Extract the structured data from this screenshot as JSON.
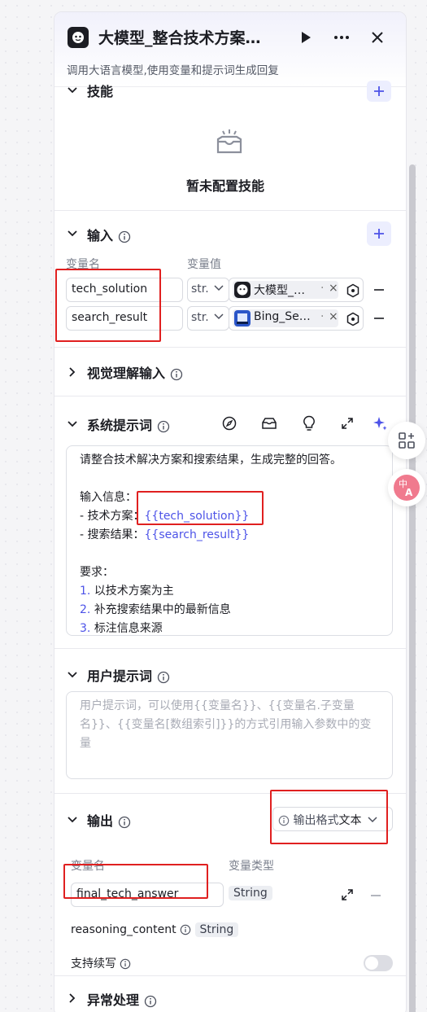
{
  "header": {
    "title": "大模型_整合技术方案…",
    "subtitle": "调用大语言模型,使用变量和提示词生成回复"
  },
  "skills": {
    "title": "技能",
    "empty_text": "暂未配置技能"
  },
  "input": {
    "title": "输入",
    "col_name": "变量名",
    "col_value": "变量值",
    "rows": [
      {
        "name": "tech_solution",
        "type": "str.",
        "ref": "大模型_…"
      },
      {
        "name": "search_result",
        "type": "str.",
        "ref": "Bing_Se…"
      }
    ]
  },
  "vision": {
    "title": "视觉理解输入"
  },
  "system_prompt": {
    "title": "系统提示词",
    "line1": "请整合技术解决方案和搜索结果，生成完整的回答。",
    "line_info": "输入信息：",
    "line_tech_label": "- 技术方案：",
    "line_tech_var": "{{tech_solution}}",
    "line_search_label": "- 搜索结果：",
    "line_search_var": "{{search_result}}",
    "req_title": "要求：",
    "req1_num": "1.",
    "req1": "以技术方案为主",
    "req2_num": "2.",
    "req2": "补充搜索结果中的最新信息",
    "req3_num": "3.",
    "req3": "标注信息来源"
  },
  "user_prompt": {
    "title": "用户提示词",
    "placeholder": "用户提示词，可以使用{{变量名}}、{{变量名.子变量名}}、{{变量名[数组索引]}}的方式引用输入参数中的变量"
  },
  "output": {
    "title": "输出",
    "format_label": "输出格式",
    "format_value": "文本",
    "col_name": "变量名",
    "col_type": "变量类型",
    "var_name": "final_tech_answer",
    "var_type": "String",
    "reasoning_name": "reasoning_content",
    "reasoning_type": "String",
    "continue_label": "支持续写"
  },
  "exception": {
    "title": "异常处理"
  },
  "colors": {
    "accent": "#4d53e8",
    "highlight": "#e02020"
  }
}
